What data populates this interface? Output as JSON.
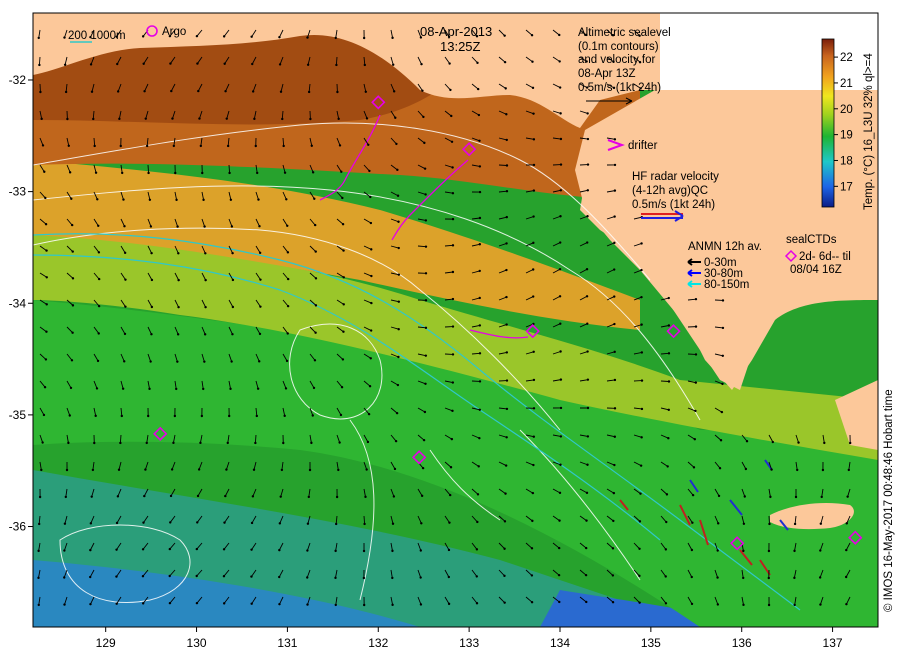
{
  "title": {
    "date": "08-Apr-2013",
    "time": "13:25Z"
  },
  "axes": {
    "x_ticks": [
      "129",
      "130",
      "131",
      "132",
      "133",
      "134",
      "135",
      "136",
      "137"
    ],
    "y_ticks": [
      "-32",
      "-33",
      "-34",
      "-35",
      "-36"
    ],
    "x_range": [
      128.2,
      137.5
    ],
    "y_range": [
      -36.9,
      -31.4
    ]
  },
  "legend_top_left": {
    "isobaths": "200  1000m",
    "argo": "Argo"
  },
  "altimetry_note": {
    "line1": "Altimetric sealevel",
    "line2": "(0.1m contours)",
    "line3": "and velocity for",
    "line4": "08-Apr 13Z",
    "line5": "0.5m/s (1kt 24h)"
  },
  "drifter_note": "drifter",
  "hf_radar_note": {
    "line1": "HF radar velocity",
    "line2": "(4-12h avg)QC",
    "line3": "0.5m/s (1kt 24h)"
  },
  "anmn_note": {
    "title": "ANMN 12h av.",
    "items": [
      {
        "label": "0-30m",
        "color": "#000000"
      },
      {
        "label": "30-80m",
        "color": "#0000ff"
      },
      {
        "label": "80-150m",
        "color": "#00e5e5"
      }
    ]
  },
  "sealctd_note": {
    "line1": "sealCTDs",
    "line2": "2d- 6d-- til",
    "line3": "08/04 16Z"
  },
  "colorbar": {
    "label": "Temp. (°C) 16_L3U 32% ql>=4",
    "ticks": [
      "22",
      "21",
      "20",
      "19",
      "18",
      "17"
    ],
    "range": [
      16.2,
      22.7
    ]
  },
  "credit": "© IMOS 16-May-2017 00:48:46 Hobart time",
  "colors": {
    "land": "#fcc89a",
    "warm": "#b25010",
    "mid": "#e8a020",
    "cool": "#22b02a",
    "cold": "#1e5ad8",
    "contour": "#ffffff",
    "isobath": "#30c8c8",
    "argo": "#e600e6"
  },
  "argo_floats": [
    {
      "lon": 132.0,
      "lat": -32.2
    },
    {
      "lon": 133.0,
      "lat": -32.62
    },
    {
      "lon": 133.7,
      "lat": -34.25
    },
    {
      "lon": 129.6,
      "lat": -35.17
    },
    {
      "lon": 132.45,
      "lat": -35.38
    },
    {
      "lon": 135.25,
      "lat": -34.25
    },
    {
      "lon": 135.95,
      "lat": -36.15
    },
    {
      "lon": 137.25,
      "lat": -36.1
    }
  ]
}
